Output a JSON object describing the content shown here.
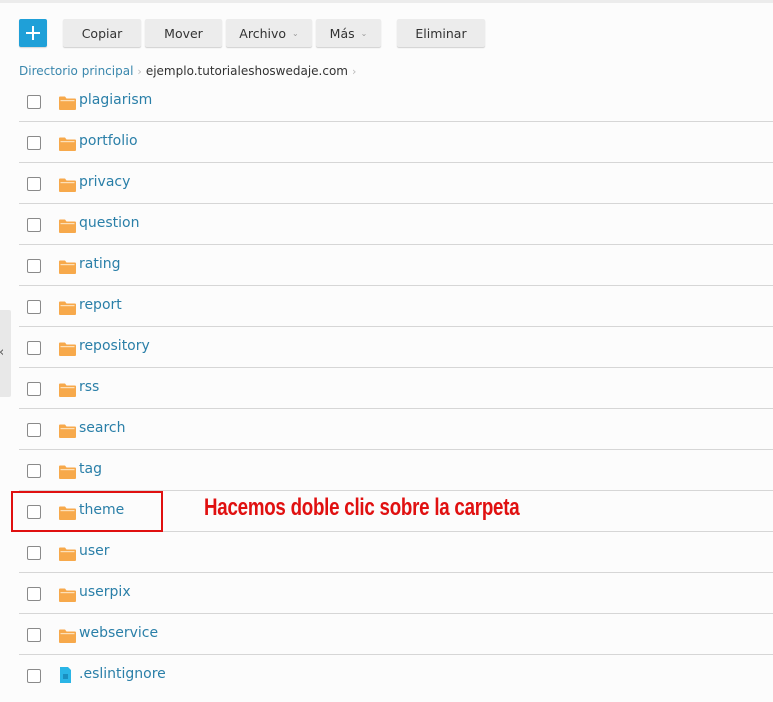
{
  "toolbar": {
    "add_icon": "plus-icon",
    "buttons": [
      {
        "label": "Copiar",
        "dropdown": false
      },
      {
        "label": "Mover",
        "dropdown": false
      },
      {
        "label": "Archivo",
        "dropdown": true
      },
      {
        "label": "Más",
        "dropdown": true
      },
      {
        "label": "Eliminar",
        "dropdown": false
      }
    ],
    "dropdown_glyph": "⌄"
  },
  "breadcrumb": {
    "root": "Directorio principal",
    "separator": "›",
    "current": "ejemplo.tutorialeshoswedaje.com"
  },
  "side_panel_toggle": "‹",
  "files": [
    {
      "name": "plagiarism",
      "type": "folder"
    },
    {
      "name": "portfolio",
      "type": "folder"
    },
    {
      "name": "privacy",
      "type": "folder"
    },
    {
      "name": "question",
      "type": "folder"
    },
    {
      "name": "rating",
      "type": "folder"
    },
    {
      "name": "report",
      "type": "folder"
    },
    {
      "name": "repository",
      "type": "folder"
    },
    {
      "name": "rss",
      "type": "folder"
    },
    {
      "name": "search",
      "type": "folder"
    },
    {
      "name": "tag",
      "type": "folder"
    },
    {
      "name": "theme",
      "type": "folder"
    },
    {
      "name": "user",
      "type": "folder"
    },
    {
      "name": "userpix",
      "type": "folder"
    },
    {
      "name": "webservice",
      "type": "folder"
    },
    {
      "name": ".eslintignore",
      "type": "file"
    }
  ],
  "annotation": {
    "text": "Hacemos doble clic sobre la carpeta",
    "target": "theme"
  },
  "colors": {
    "accent": "#1fa0d8",
    "link": "#2a7fa8",
    "folder": "#f7a94b",
    "file": "#2ab5e6",
    "annotation": "#e01010"
  }
}
